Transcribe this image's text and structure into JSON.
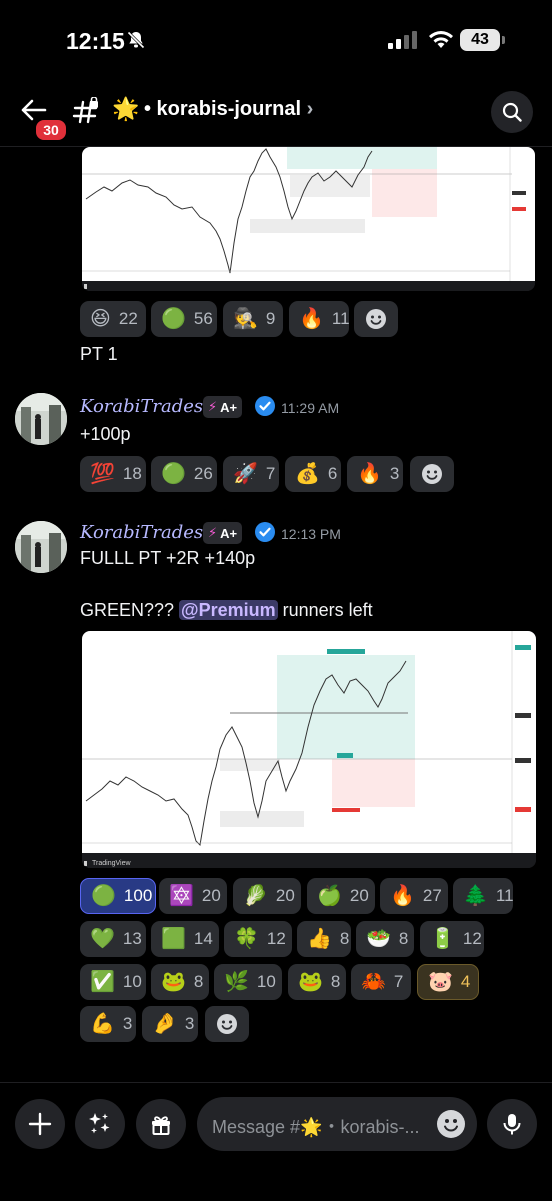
{
  "status_bar": {
    "time": "12:15",
    "battery": "43"
  },
  "header": {
    "unread_count": "30",
    "star_emoji": "🌟",
    "channel_name": "• korabis-journal",
    "chevron": "›"
  },
  "messages": [
    {
      "text": "PT 1",
      "reactions": [
        {
          "emoji": "😆",
          "count": "22"
        },
        {
          "emoji": "🟢",
          "count": "56"
        },
        {
          "emoji": "🕵️",
          "count": "9"
        },
        {
          "emoji": "🔥",
          "count": "11"
        }
      ]
    },
    {
      "author": "KorabiTrades",
      "tag": "A+",
      "tag_bolt": "⚡",
      "time": "11:29 AM",
      "text": "+100p",
      "reactions": [
        {
          "emoji": "💯",
          "count": "18"
        },
        {
          "emoji": "🟢",
          "count": "26"
        },
        {
          "emoji": "🚀",
          "count": "7"
        },
        {
          "emoji": "💰",
          "count": "6"
        },
        {
          "emoji": "🔥",
          "count": "3"
        }
      ]
    },
    {
      "author": "KorabiTrades",
      "tag": "A+",
      "tag_bolt": "⚡",
      "time": "12:13 PM",
      "text_line1": "FULLL PT +2R +140p",
      "text_line2_prefix": "GREEN??? ",
      "mention": "@Premium",
      "text_line2_suffix": " runners left",
      "chart_footer": "TradingView",
      "reactions_row1": [
        {
          "emoji": "🟢",
          "count": "100"
        },
        {
          "emoji": "🔯",
          "count": "20"
        },
        {
          "emoji": "🥬",
          "count": "20"
        },
        {
          "emoji": "🍏",
          "count": "20"
        },
        {
          "emoji": "🔥",
          "count": "27"
        },
        {
          "emoji": "🌲",
          "count": "11"
        }
      ],
      "reactions_row2": [
        {
          "emoji": "💚",
          "count": "13"
        },
        {
          "emoji": "🟩",
          "count": "14"
        },
        {
          "emoji": "🍀",
          "count": "12"
        },
        {
          "emoji": "👍",
          "count": "8"
        },
        {
          "emoji": "🥗",
          "count": "8"
        },
        {
          "emoji": "🔋",
          "count": "12"
        }
      ],
      "reactions_row3": [
        {
          "emoji": "✅",
          "count": "10"
        },
        {
          "emoji": "🐸",
          "count": "8"
        },
        {
          "emoji": "🌿",
          "count": "10"
        },
        {
          "emoji": "🐸",
          "count": "8"
        },
        {
          "emoji": "🦀",
          "count": "7"
        },
        {
          "emoji": "🐷",
          "count": "4"
        }
      ],
      "reactions_row4": [
        {
          "emoji": "💪",
          "count": "3"
        },
        {
          "emoji": "🤌",
          "count": "3"
        }
      ]
    }
  ],
  "chart_top_footer": "TradingView",
  "composer": {
    "placeholder": "Message #🌟・korabis-..."
  },
  "colors": {
    "accent": "#5865f2",
    "username": "#b7b9ff",
    "mention_bg": "#3b3a66",
    "bg": "#000000"
  }
}
